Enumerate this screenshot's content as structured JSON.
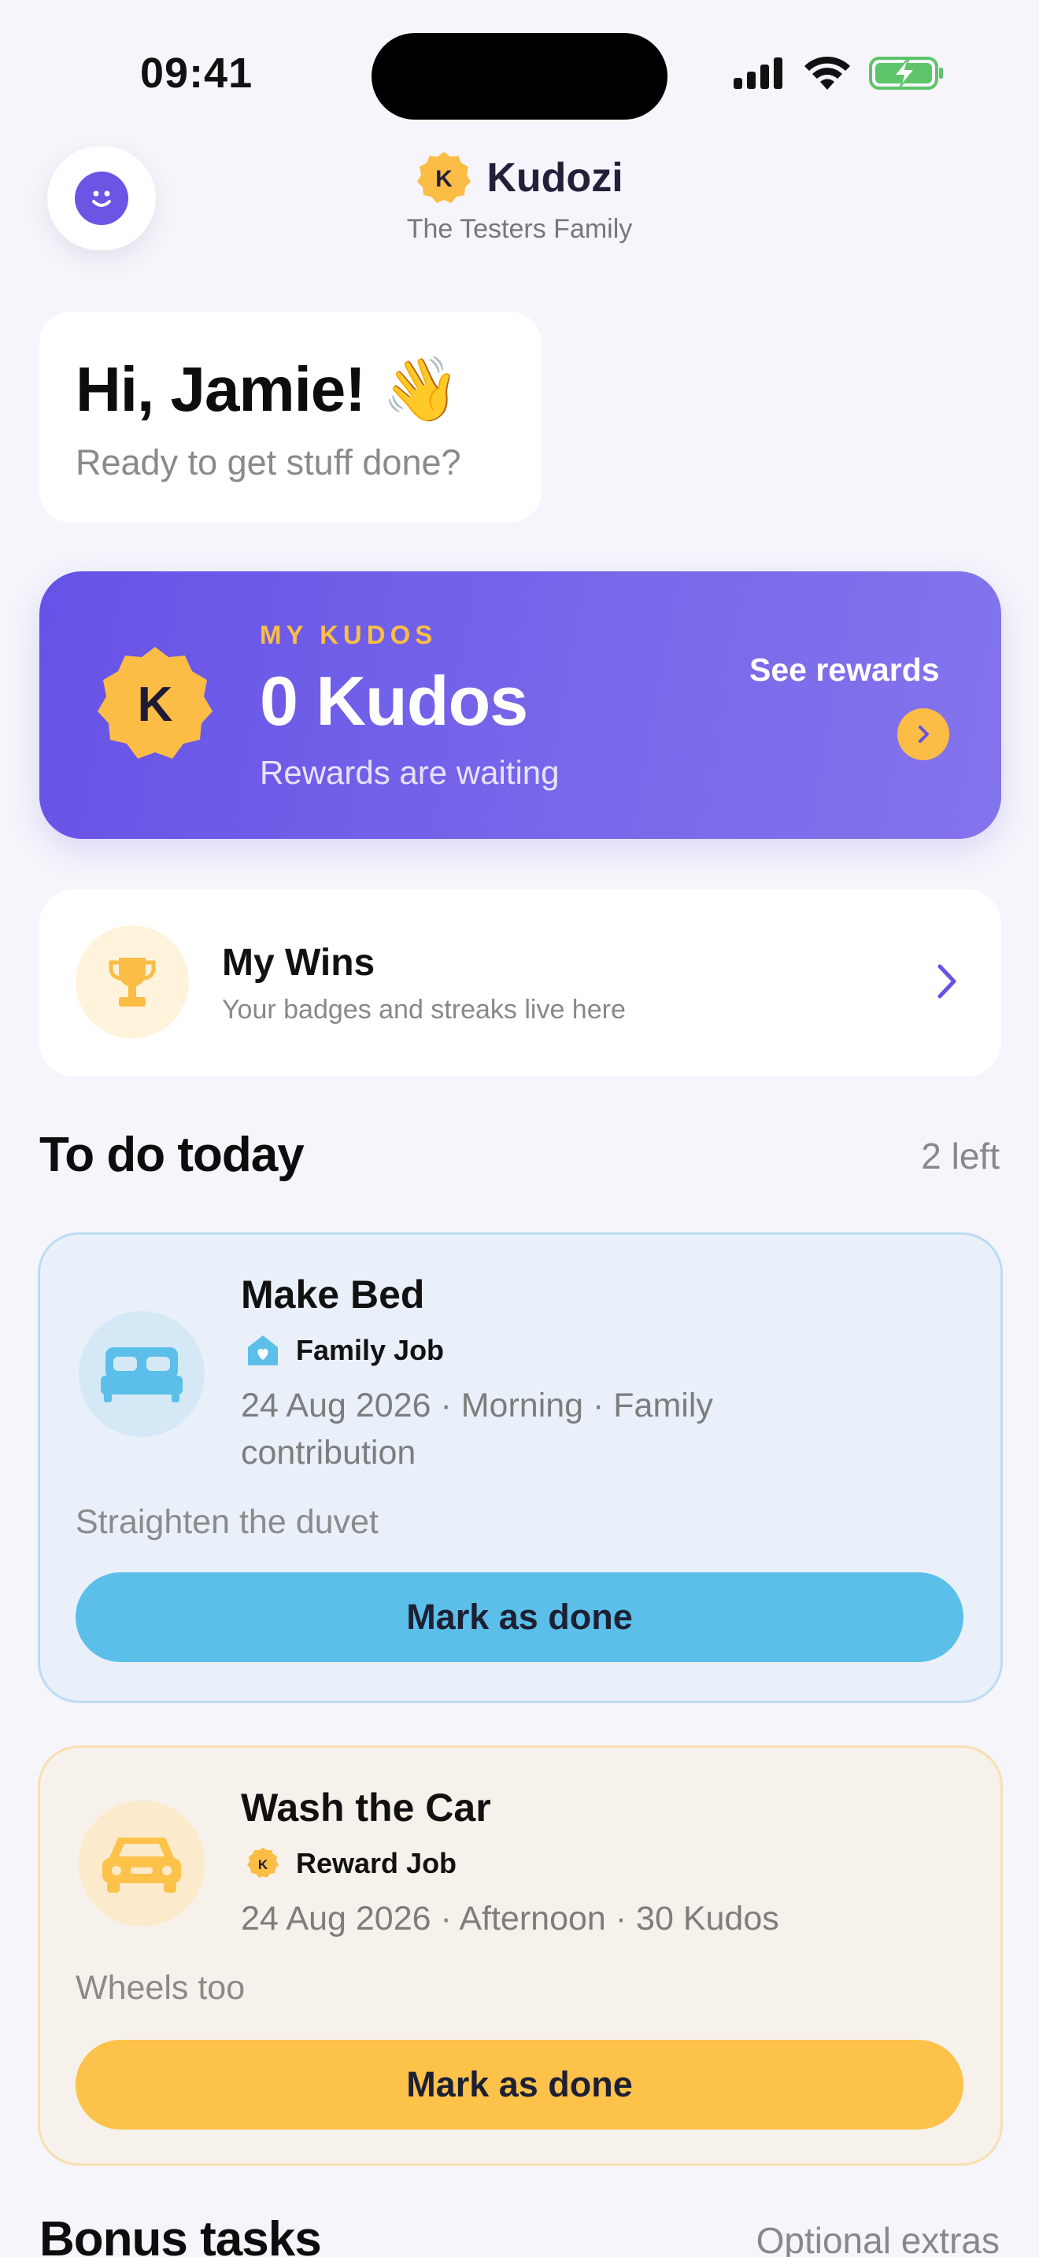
{
  "status_bar": {
    "time": "09:41",
    "icons": [
      "cellular-signal-icon",
      "wifi-icon",
      "battery-charging-icon"
    ]
  },
  "header": {
    "brand_name": "Kudozi",
    "brand_letter": "K",
    "family_name": "The Testers Family",
    "avatar_icon": "smiley-face-icon"
  },
  "greeting": {
    "title": "Hi, Jamie! 👋",
    "subtitle": "Ready to get stuff done?"
  },
  "kudos": {
    "label": "MY KUDOS",
    "value": "0 Kudos",
    "subtitle": "Rewards are waiting",
    "coin_letter": "K",
    "link_label": "See rewards"
  },
  "wins": {
    "title": "My Wins",
    "subtitle": "Your badges and streaks live here",
    "icon": "trophy-icon"
  },
  "today": {
    "title": "To do today",
    "count": "2 left"
  },
  "tasks": [
    {
      "title": "Make Bed",
      "tag": "Family Job",
      "tag_icon": "house-heart-icon",
      "meta": "24 Aug 2026 · Morning · Family contribution",
      "note": "Straighten the duvet",
      "button": "Mark as done",
      "icon": "bed-icon",
      "accent": "#5bbfea"
    },
    {
      "title": "Wash the Car",
      "tag": "Reward Job",
      "tag_icon": "kudos-coin-icon",
      "tag_letter": "K",
      "meta": "24 Aug 2026 · Afternoon · 30 Kudos",
      "note": "Wheels too",
      "button": "Mark as done",
      "icon": "car-icon",
      "accent": "#fdc24a"
    }
  ],
  "bonus": {
    "title": "Bonus tasks",
    "subtitle": "Optional extras"
  },
  "colors": {
    "brand_purple": "#6652e6",
    "kudos_gold": "#fbbd45",
    "family_blue": "#5bbfea",
    "background": "#f5f5fb"
  }
}
